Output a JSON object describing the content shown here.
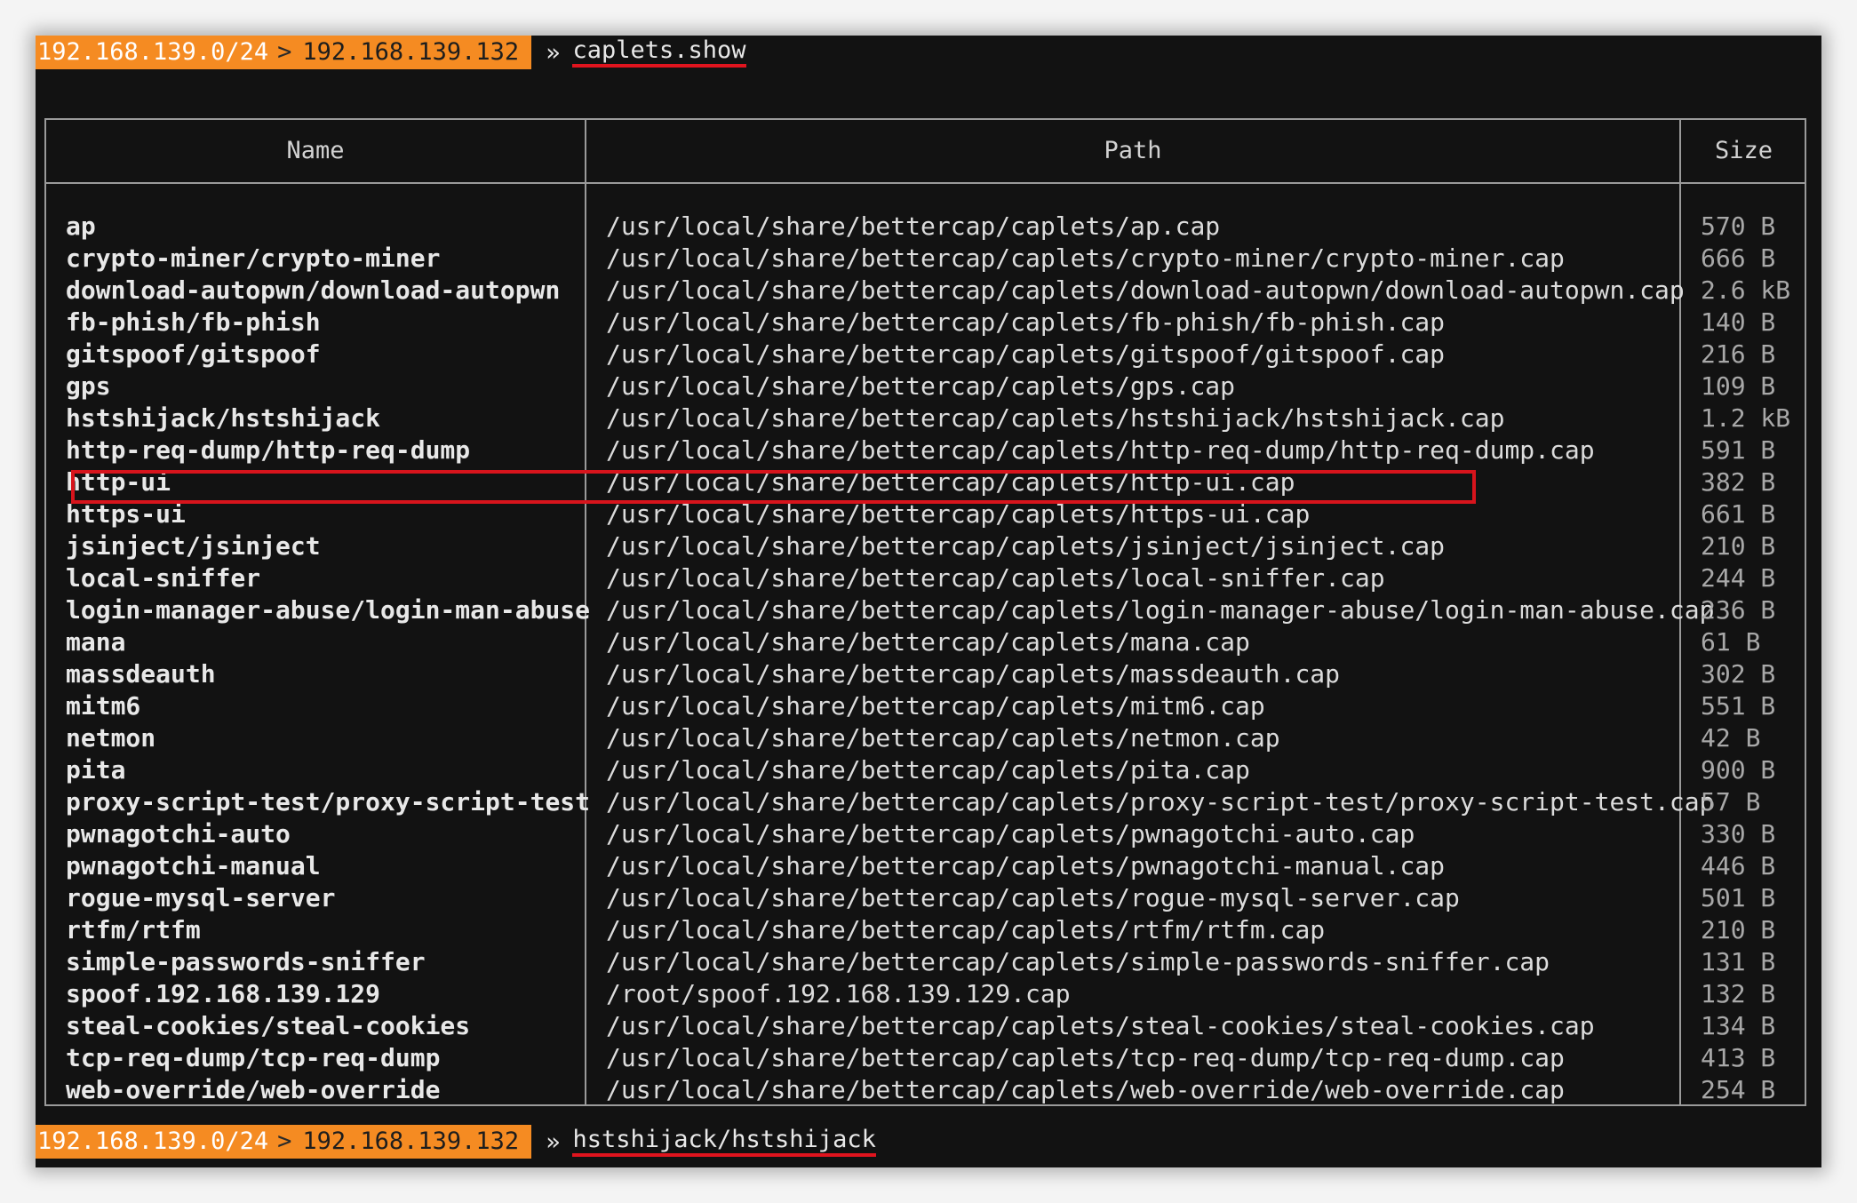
{
  "top_prompt": {
    "network": "192.168.139.0/24",
    "arrow": ">",
    "host": "192.168.139.132",
    "separator": "»",
    "command": "caplets.show"
  },
  "table": {
    "columns": [
      "Name",
      "Path",
      "Size"
    ],
    "rows": [
      {
        "name": "ap",
        "path": "/usr/local/share/bettercap/caplets/ap.cap",
        "size": "570 B"
      },
      {
        "name": "crypto-miner/crypto-miner",
        "path": "/usr/local/share/bettercap/caplets/crypto-miner/crypto-miner.cap",
        "size": "666 B"
      },
      {
        "name": "download-autopwn/download-autopwn",
        "path": "/usr/local/share/bettercap/caplets/download-autopwn/download-autopwn.cap",
        "size": "2.6 kB"
      },
      {
        "name": "fb-phish/fb-phish",
        "path": "/usr/local/share/bettercap/caplets/fb-phish/fb-phish.cap",
        "size": "140 B"
      },
      {
        "name": "gitspoof/gitspoof",
        "path": "/usr/local/share/bettercap/caplets/gitspoof/gitspoof.cap",
        "size": "216 B"
      },
      {
        "name": "gps",
        "path": "/usr/local/share/bettercap/caplets/gps.cap",
        "size": "109 B"
      },
      {
        "name": "hstshijack/hstshijack",
        "path": "/usr/local/share/bettercap/caplets/hstshijack/hstshijack.cap",
        "size": "1.2 kB"
      },
      {
        "name": "http-req-dump/http-req-dump",
        "path": "/usr/local/share/bettercap/caplets/http-req-dump/http-req-dump.cap",
        "size": "591 B"
      },
      {
        "name": "http-ui",
        "path": "/usr/local/share/bettercap/caplets/http-ui.cap",
        "size": "382 B"
      },
      {
        "name": "https-ui",
        "path": "/usr/local/share/bettercap/caplets/https-ui.cap",
        "size": "661 B"
      },
      {
        "name": "jsinject/jsinject",
        "path": "/usr/local/share/bettercap/caplets/jsinject/jsinject.cap",
        "size": "210 B"
      },
      {
        "name": "local-sniffer",
        "path": "/usr/local/share/bettercap/caplets/local-sniffer.cap",
        "size": "244 B"
      },
      {
        "name": "login-manager-abuse/login-man-abuse",
        "path": "/usr/local/share/bettercap/caplets/login-manager-abuse/login-man-abuse.cap",
        "size": "236 B"
      },
      {
        "name": "mana",
        "path": "/usr/local/share/bettercap/caplets/mana.cap",
        "size": "61 B"
      },
      {
        "name": "massdeauth",
        "path": "/usr/local/share/bettercap/caplets/massdeauth.cap",
        "size": "302 B"
      },
      {
        "name": "mitm6",
        "path": "/usr/local/share/bettercap/caplets/mitm6.cap",
        "size": "551 B"
      },
      {
        "name": "netmon",
        "path": "/usr/local/share/bettercap/caplets/netmon.cap",
        "size": "42 B"
      },
      {
        "name": "pita",
        "path": "/usr/local/share/bettercap/caplets/pita.cap",
        "size": "900 B"
      },
      {
        "name": "proxy-script-test/proxy-script-test",
        "path": "/usr/local/share/bettercap/caplets/proxy-script-test/proxy-script-test.cap",
        "size": "57 B"
      },
      {
        "name": "pwnagotchi-auto",
        "path": "/usr/local/share/bettercap/caplets/pwnagotchi-auto.cap",
        "size": "330 B"
      },
      {
        "name": "pwnagotchi-manual",
        "path": "/usr/local/share/bettercap/caplets/pwnagotchi-manual.cap",
        "size": "446 B"
      },
      {
        "name": "rogue-mysql-server",
        "path": "/usr/local/share/bettercap/caplets/rogue-mysql-server.cap",
        "size": "501 B"
      },
      {
        "name": "rtfm/rtfm",
        "path": "/usr/local/share/bettercap/caplets/rtfm/rtfm.cap",
        "size": "210 B"
      },
      {
        "name": "simple-passwords-sniffer",
        "path": "/usr/local/share/bettercap/caplets/simple-passwords-sniffer.cap",
        "size": "131 B"
      },
      {
        "name": "spoof.192.168.139.129",
        "path": "/root/spoof.192.168.139.129.cap",
        "size": "132 B"
      },
      {
        "name": "steal-cookies/steal-cookies",
        "path": "/usr/local/share/bettercap/caplets/steal-cookies/steal-cookies.cap",
        "size": "134 B"
      },
      {
        "name": "tcp-req-dump/tcp-req-dump",
        "path": "/usr/local/share/bettercap/caplets/tcp-req-dump/tcp-req-dump.cap",
        "size": "413 B"
      },
      {
        "name": "web-override/web-override",
        "path": "/usr/local/share/bettercap/caplets/web-override/web-override.cap",
        "size": "254 B"
      }
    ]
  },
  "bottom_prompt": {
    "network": "192.168.139.0/24",
    "arrow": ">",
    "host": "192.168.139.132",
    "separator": "»",
    "command": "hstshijack/hstshijack"
  },
  "colors": {
    "prompt_bg": "#f58b22",
    "terminal_bg": "#121212",
    "annotation_red": "#d7141c"
  }
}
